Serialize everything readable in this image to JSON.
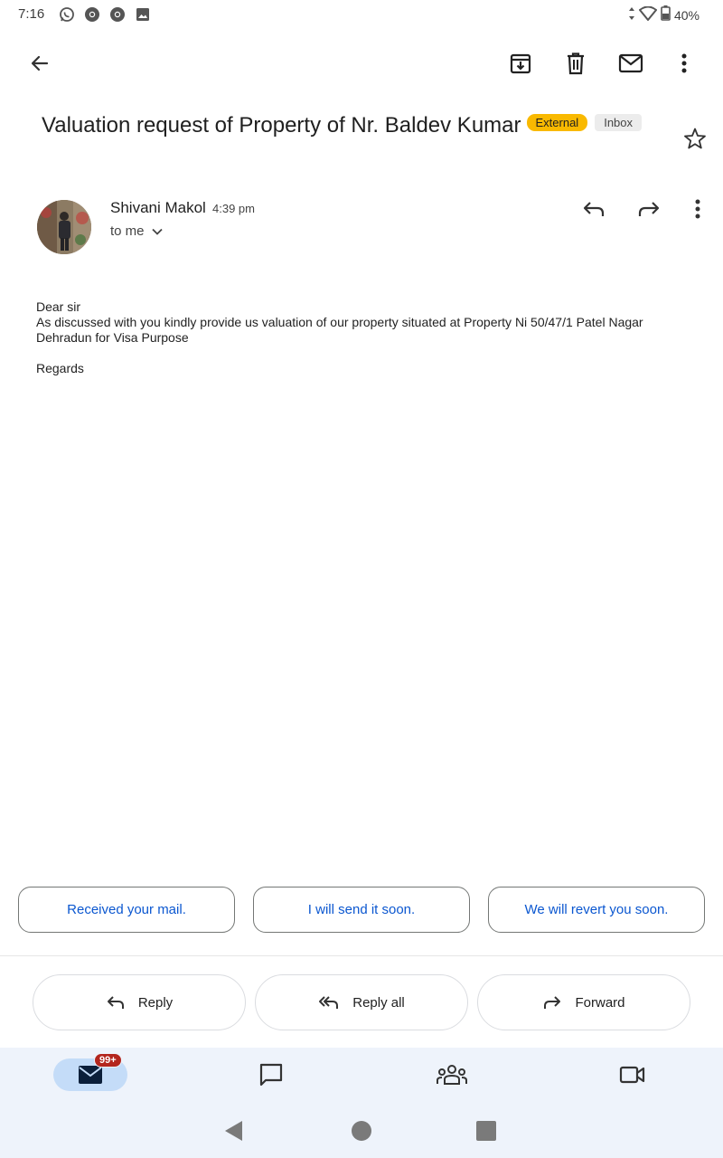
{
  "status_bar": {
    "time": "7:16",
    "battery": "40%",
    "notification_icons": [
      "whatsapp-icon",
      "chrome-icon",
      "chrome-icon",
      "image-icon"
    ]
  },
  "toolbar": {
    "icons": [
      "back-arrow-icon",
      "archive-icon",
      "trash-icon",
      "mark-unread-icon",
      "more-vert-icon"
    ]
  },
  "email": {
    "subject": "Valuation request of Property of Nr. Baldev Kumar",
    "labels": {
      "external": "External",
      "inbox": "Inbox"
    },
    "sender": "Shivani Makol",
    "time": "4:39 pm",
    "recipient": "to me",
    "body": {
      "greeting": "Dear sir",
      "line1": "As discussed with you kindly provide us valuation of our property situated at Property Ni 50/47/1 Patel Nagar",
      "line2": "Dehradun for Visa Purpose",
      "signoff": "Regards"
    }
  },
  "smart_replies": [
    "Received your mail.",
    "I will send it soon.",
    "We will revert you soon."
  ],
  "actions": {
    "reply": "Reply",
    "reply_all": "Reply all",
    "forward": "Forward"
  },
  "bottom_nav": {
    "mail_badge": "99+",
    "items": [
      "mail-icon",
      "chat-icon",
      "spaces-icon",
      "meet-icon"
    ]
  },
  "colors": {
    "accent": "#0b57d0",
    "external_badge": "#f9b900",
    "nav_bg": "#eef3fb",
    "nav_pill": "#c4dcf8",
    "count_badge": "#b3261e"
  }
}
